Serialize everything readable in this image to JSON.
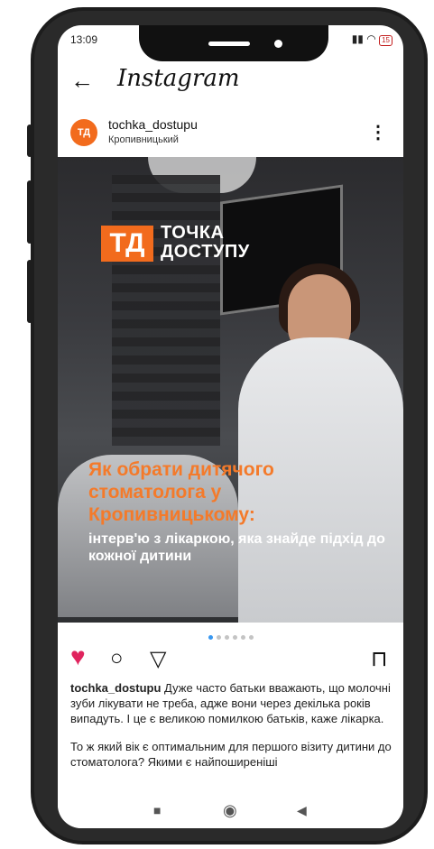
{
  "status": {
    "time": "13:09",
    "battery": "15"
  },
  "appbar": {
    "back": "←",
    "title": "Instagram"
  },
  "post": {
    "avatar_text": "ТД",
    "username": "tochka_dostupu",
    "location": "Кропивницький",
    "more": "⋮"
  },
  "media": {
    "logo_mark": "ТД",
    "logo_line1": "ТОЧКА",
    "logo_line2": "ДОСТУПУ",
    "headline": "Як обрати дитячого стоматолога у Кропивницькому:",
    "subline": "інтерв'ю з лікаркою, яка знайде підхід до кожної дитини"
  },
  "carousel": {
    "total": 6,
    "active": 1
  },
  "actions": {
    "like": "♥",
    "comment": "○",
    "share": "▽",
    "save": "⊏"
  },
  "caption": {
    "username": "tochka_dostupu",
    "para1": "Дуже часто батьки вважають, що молочні зуби лікувати не треба, адже вони через декілька років випадуть. І це є великою помилкою батьків, каже лікарка.",
    "para2": "То ж який вік є оптимальним для першого візиту дитини до стоматолога? Якими є найпоширеніші"
  },
  "navbar": {
    "recents": "■",
    "home": "◉",
    "back": "◀"
  },
  "colors": {
    "accent": "#f26b1d",
    "like": "#e0245e",
    "dot_active": "#3897f0"
  }
}
